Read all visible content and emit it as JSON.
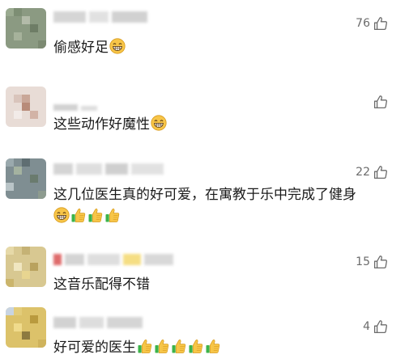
{
  "comments": [
    {
      "text": "偷感好足",
      "likes": "76",
      "emojis": [
        "grin"
      ]
    },
    {
      "text": "这些动作好魔性",
      "likes": "",
      "emojis": [
        "grin"
      ]
    },
    {
      "text": "这几位医生真的好可爱，在寓教于乐中完成了健身",
      "likes": "22",
      "emojis": [
        "grin",
        "thumbs",
        "thumbs",
        "thumbs"
      ]
    },
    {
      "text": "这音乐配得不错",
      "likes": "15",
      "emojis": []
    },
    {
      "text": "好可爱的医生",
      "likes": "4",
      "emojis": [
        "thumbs",
        "thumbs",
        "thumbs",
        "thumbs",
        "thumbs"
      ]
    }
  ],
  "icons": {
    "like": "thumbs-up-outline-icon",
    "grin": "grinning-face-emoji",
    "thumbs": "thumbs-up-emoji"
  },
  "colors": {
    "text": "#1a1a1a",
    "meta": "#6b6b6b",
    "emoji_yellow": "#f7c548",
    "emoji_green": "#3db34a"
  }
}
